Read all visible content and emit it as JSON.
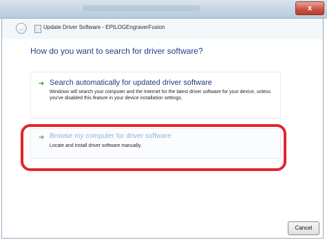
{
  "window": {
    "close_glyph": "x",
    "back_glyph": "←"
  },
  "dialog": {
    "title": "Update Driver Software - EPILOGEngraverFusion",
    "heading": "How do you want to search for driver software?",
    "options": [
      {
        "title": "Search automatically for updated driver software",
        "description": "Windows will search your computer and the Internet for the latest driver software for your device, unless you've disabled this feature in your device installation settings."
      },
      {
        "title": "Browse my computer for driver software",
        "description": "Locate and install driver software manually."
      }
    ],
    "arrow_glyph": "➔",
    "cancel_label": "Cancel"
  },
  "colors": {
    "heading": "#2a3a8a",
    "highlight": "#e3242b",
    "arrow": "#2f9a2a"
  }
}
